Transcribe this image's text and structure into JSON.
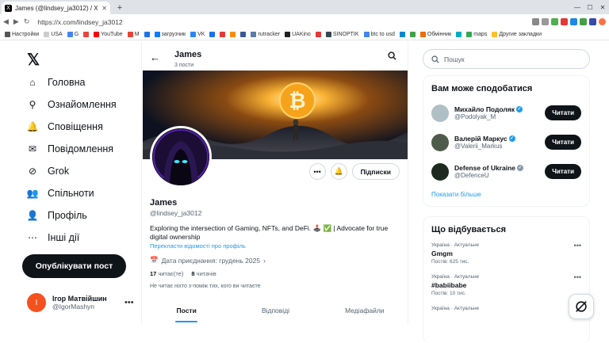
{
  "browser": {
    "tab_title": "James (@lindsey_ja3012) / X",
    "tab_icon": "X",
    "url": "https://x.com/lindsey_ja3012",
    "bookmarks": [
      {
        "label": "Настройки",
        "color": "#555"
      },
      {
        "label": "USA",
        "color": "#ccc"
      },
      {
        "label": "G",
        "color": "#4285f4"
      },
      {
        "label": "",
        "color": "#e8453c"
      },
      {
        "label": "YouTube",
        "color": "#f00"
      },
      {
        "label": "M",
        "color": "#ea4335"
      },
      {
        "label": "",
        "color": "#1a73e8"
      },
      {
        "label": "загрузчик",
        "color": "#0a7cff"
      },
      {
        "label": "VK",
        "color": "#2787f5"
      },
      {
        "label": "",
        "color": "#1a73e8"
      },
      {
        "label": "",
        "color": "#e53935"
      },
      {
        "label": "",
        "color": "#fb8c00"
      },
      {
        "label": "",
        "color": "#3b5998"
      },
      {
        "label": "rutracker",
        "color": "#5a7ca6"
      },
      {
        "label": "UAKino",
        "color": "#222"
      },
      {
        "label": "",
        "color": "#e53935"
      },
      {
        "label": "SINOPTIK",
        "color": "#37474f"
      },
      {
        "label": "btc to usd",
        "color": "#4285f4"
      },
      {
        "label": "",
        "color": "#0288d1"
      },
      {
        "label": "",
        "color": "#43a047"
      },
      {
        "label": "Обмінник",
        "color": "#ef6c00"
      },
      {
        "label": "",
        "color": "#00acc1"
      },
      {
        "label": "maps",
        "color": "#34a853"
      },
      {
        "label": "Другие закладки",
        "color": "#fbc02d"
      }
    ]
  },
  "nav": {
    "items": [
      {
        "label": "Головна",
        "icon": "home-icon"
      },
      {
        "label": "Ознайомлення",
        "icon": "search-icon"
      },
      {
        "label": "Сповіщення",
        "icon": "bell-icon"
      },
      {
        "label": "Повідомлення",
        "icon": "mail-icon"
      },
      {
        "label": "Grok",
        "icon": "grok-icon"
      },
      {
        "label": "Спільноти",
        "icon": "communities-icon"
      },
      {
        "label": "Профіль",
        "icon": "profile-icon"
      },
      {
        "label": "Інші дії",
        "icon": "more-icon"
      }
    ],
    "post_button": "Опублікувати пост",
    "account": {
      "initial": "I",
      "name": "Ігор Матвійшин",
      "handle": "@IgorMashyn"
    }
  },
  "profile": {
    "header_name": "James",
    "post_count": "3 пости",
    "name": "James",
    "handle": "@lindsey_ja3012",
    "bio": "Exploring the intersection of Gaming, NFTs, and DeFi. 🕹️ ✅ | Advocate for true digital ownership",
    "translate": "Перекласти відомості про профіль",
    "joined": "Дата приєднання: грудень 2025",
    "following_count": "17",
    "following_label": "читає(те)",
    "followers_count": "8",
    "followers_label": "читачів",
    "follow_note": "Не читає ніхто з-поміж тих, кого ви читаєте",
    "follow_button": "Підписки",
    "tabs": [
      "Пости",
      "Відповіді",
      "Медіафайли"
    ]
  },
  "right": {
    "search_placeholder": "Пошук",
    "suggest_title": "Вам може сподобатися",
    "suggestions": [
      {
        "name": "Михайло Подоляк",
        "handle": "@Podolyak_M",
        "verified_color": "#1d9bf0",
        "button": "Читати"
      },
      {
        "name": "Валерій Маркус",
        "handle": "@Valerii_Markus",
        "verified_color": "#1d9bf0",
        "button": "Читати"
      },
      {
        "name": "Defense of Ukraine",
        "handle": "@DefenceU",
        "verified_color": "#829aab",
        "button": "Читати"
      }
    ],
    "show_more": "Показати більше",
    "trends_title": "Що відбувається",
    "trends": [
      {
        "context": "Україна · Актуальне",
        "name": "Gmgm",
        "posts": "Постів: 625 тис."
      },
      {
        "context": "Україна · Актуальне",
        "name": "#babiibabe",
        "posts": "Постів: 10 тис."
      },
      {
        "context": "Україна · Актуальне",
        "name": "",
        "posts": ""
      }
    ]
  }
}
